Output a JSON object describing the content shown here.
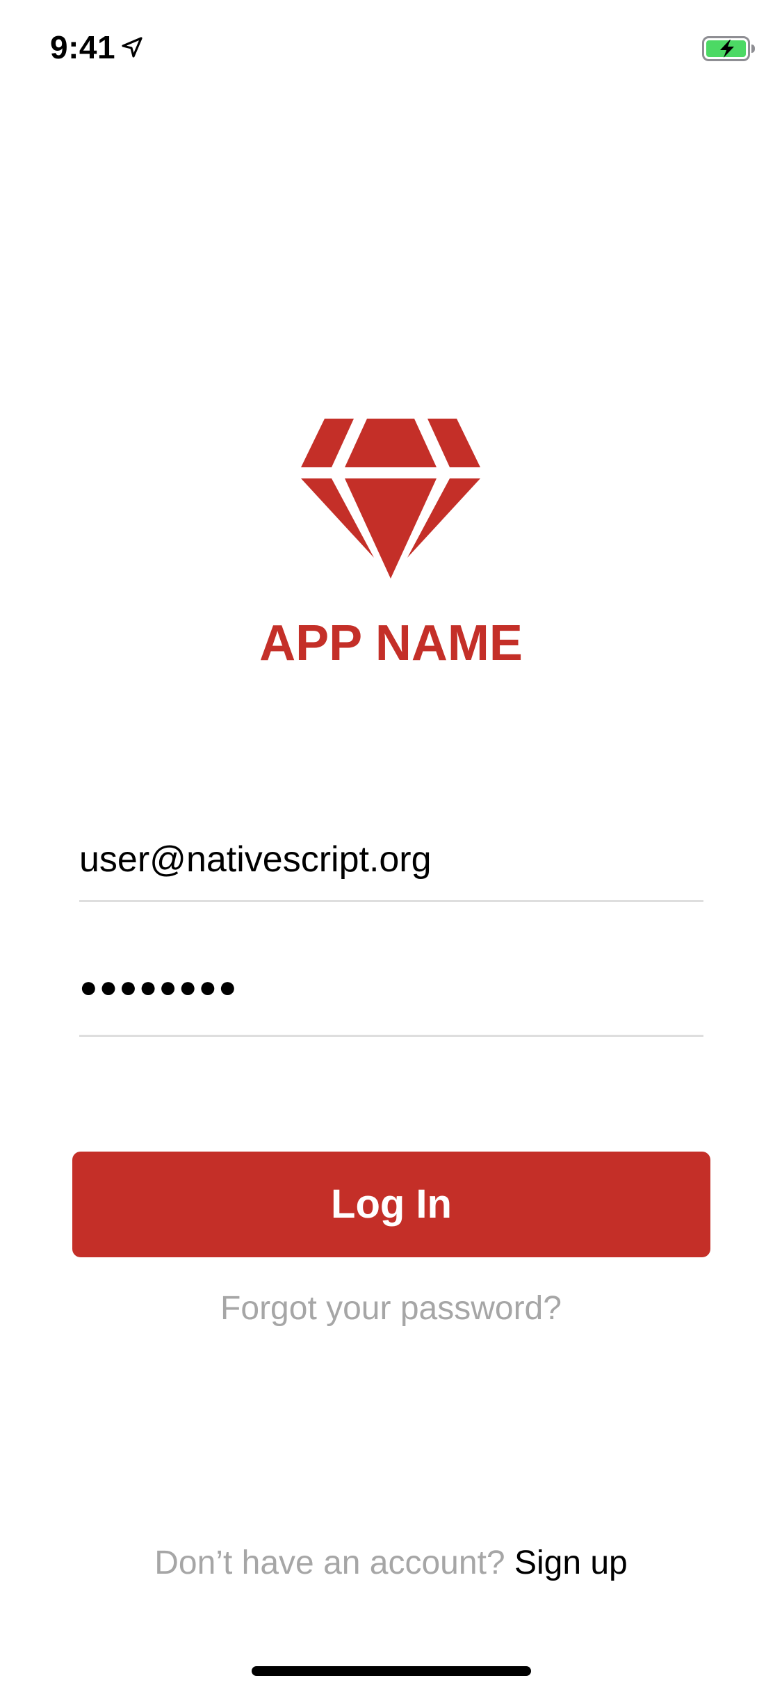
{
  "status_bar": {
    "time": "9:41",
    "location_icon": "location-arrow-icon",
    "battery_icon": "battery-charging-icon",
    "battery_color": "#4cd964"
  },
  "logo": {
    "icon": "diamond-icon",
    "color": "#c42f28"
  },
  "app_name": "APP NAME",
  "form": {
    "email_value": "user@nativescript.org",
    "password_value": "●●●●●●●●"
  },
  "login_button": {
    "label": "Log In"
  },
  "forgot_password_label": "Forgot your password?",
  "signup": {
    "prompt": "Don’t have an account?",
    "link": "Sign up"
  },
  "colors": {
    "accent": "#c42f28",
    "muted_text": "#a6a6a6",
    "divider": "#dedede",
    "home_indicator": "#000000"
  }
}
